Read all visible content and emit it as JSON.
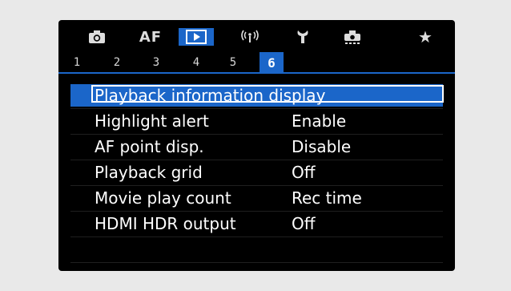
{
  "tabs": [
    {
      "name": "camera-icon",
      "label": ""
    },
    {
      "name": "af-tab",
      "label": "AF"
    },
    {
      "name": "playback-icon",
      "label": ""
    },
    {
      "name": "wireless-icon",
      "label": "((ı))"
    },
    {
      "name": "wrench-icon",
      "label": ""
    },
    {
      "name": "custom-icon",
      "label": ""
    },
    {
      "name": "star-icon",
      "label": "★"
    }
  ],
  "subtabs": [
    "1",
    "2",
    "3",
    "4",
    "5",
    "6"
  ],
  "active_subtab": "6",
  "menu": {
    "items": [
      {
        "label": "Playback information display",
        "value": ""
      },
      {
        "label": "Highlight alert",
        "value": "Enable"
      },
      {
        "label": "AF point disp.",
        "value": "Disable"
      },
      {
        "label": "Playback grid",
        "value": "Off"
      },
      {
        "label": "Movie play count",
        "value": "Rec time"
      },
      {
        "label": "HDMI HDR output",
        "value": "Off"
      }
    ]
  },
  "colors": {
    "accent": "#1b66c9",
    "background": "#000000",
    "frame": "#e9e9e9"
  }
}
